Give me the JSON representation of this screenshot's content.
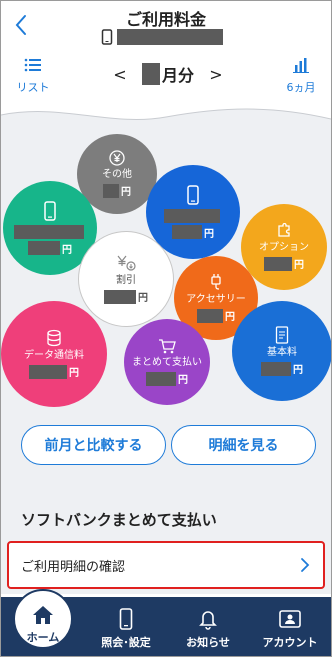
{
  "header": {
    "title": "ご利用料金",
    "back_icon": "chevron-left-icon",
    "phone_icon": "smartphone-icon"
  },
  "subbar": {
    "list_label": "リスト",
    "month_suffix": "月分",
    "prev_arrow": "<",
    "next_arrow": ">",
    "six_month_label": "6ヵ月"
  },
  "bubbles": {
    "other": {
      "label": "その他",
      "yen": "円",
      "icon": "yen-icon",
      "color": "#7d7d7d"
    },
    "phone_device": {
      "yen": "円",
      "icon": "smartphone-icon",
      "color": "#1666d8"
    },
    "phone_green": {
      "yen": "円",
      "icon": "smartphone-icon",
      "color": "#17b58a"
    },
    "option": {
      "label": "オプション",
      "yen": "円",
      "icon": "puzzle-icon",
      "color": "#f3a71c"
    },
    "discount": {
      "label": "割引",
      "yen": "円",
      "icon": "discount-icon",
      "color": "#ffffff"
    },
    "accessory": {
      "label": "アクセサリー",
      "yen": "円",
      "icon": "plug-icon",
      "color": "#f06a1a"
    },
    "data": {
      "label": "データ通信料",
      "yen": "円",
      "icon": "database-icon",
      "color": "#ef3f7a"
    },
    "matomete": {
      "label": "まとめて支払い",
      "yen": "円",
      "icon": "cart-icon",
      "color": "#9a45c8"
    },
    "basic": {
      "label": "基本料",
      "yen": "円",
      "icon": "document-icon",
      "color": "#1a6fd6"
    }
  },
  "buttons": {
    "compare": "前月と比較する",
    "detail": "明細を見る"
  },
  "section": {
    "title": "ソフトバンクまとめて支払い",
    "row_label": "ご利用明細の確認"
  },
  "bottomnav": {
    "home": "ホーム",
    "inquiry": "照会･設定",
    "notice": "お知らせ",
    "account": "アカウント"
  },
  "colors": {
    "accent": "#1e7bd8",
    "nav_bg": "#1e3a63",
    "highlight_border": "#e0201f"
  }
}
